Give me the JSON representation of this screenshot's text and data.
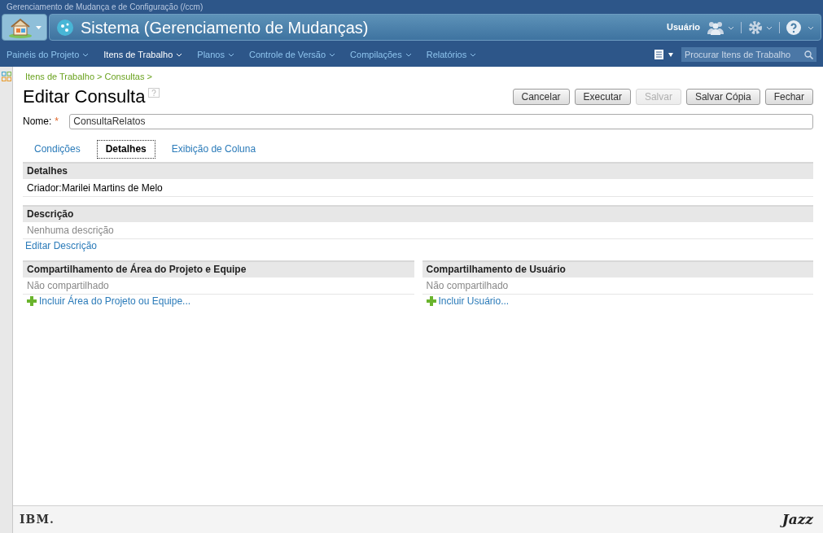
{
  "app_title": "Gerenciamento de Mudança e de Configuração (/ccm)",
  "banner": {
    "title": "Sistema (Gerenciamento de Mudanças)",
    "user": "Usuário"
  },
  "menu": [
    {
      "label": "Painéis do Projeto",
      "selected": false
    },
    {
      "label": "Itens de Trabalho",
      "selected": true
    },
    {
      "label": "Planos",
      "selected": false
    },
    {
      "label": "Controle de Versão",
      "selected": false
    },
    {
      "label": "Compilações",
      "selected": false
    },
    {
      "label": "Relatórios",
      "selected": false
    }
  ],
  "search": {
    "placeholder": "Procurar Itens de Trabalho"
  },
  "breadcrumb": "Itens de Trabalho > Consultas >",
  "page_title": "Editar Consulta",
  "buttons": [
    {
      "label": "Cancelar",
      "disabled": false
    },
    {
      "label": "Executar",
      "disabled": false
    },
    {
      "label": "Salvar",
      "disabled": true
    },
    {
      "label": "Salvar Cópia",
      "disabled": false
    },
    {
      "label": "Fechar",
      "disabled": false
    }
  ],
  "name_field": {
    "label": "Nome:",
    "required_mark": "*",
    "value": "ConsultaRelatos"
  },
  "tabs": [
    {
      "label": "Condições",
      "selected": false
    },
    {
      "label": "Detalhes",
      "selected": true
    },
    {
      "label": "Exibição de Coluna",
      "selected": false
    }
  ],
  "details": {
    "header": "Detalhes",
    "creator": "Criador:Marilei Martins de Melo"
  },
  "description": {
    "header": "Descrição",
    "text": "Nenhuma descrição",
    "link": "Editar Descrição"
  },
  "sharing": [
    {
      "header": "Compartilhamento de Área do Projeto e Equipe",
      "status": "Não compartilhado",
      "link": "Incluir Área do Projeto ou Equipe..."
    },
    {
      "header": "Compartilhamento de Usuário",
      "status": "Não compartilhado",
      "link": "Incluir Usuário..."
    }
  ],
  "footer": {
    "left_logo": "IBM.",
    "right_logo": "Jazz"
  }
}
